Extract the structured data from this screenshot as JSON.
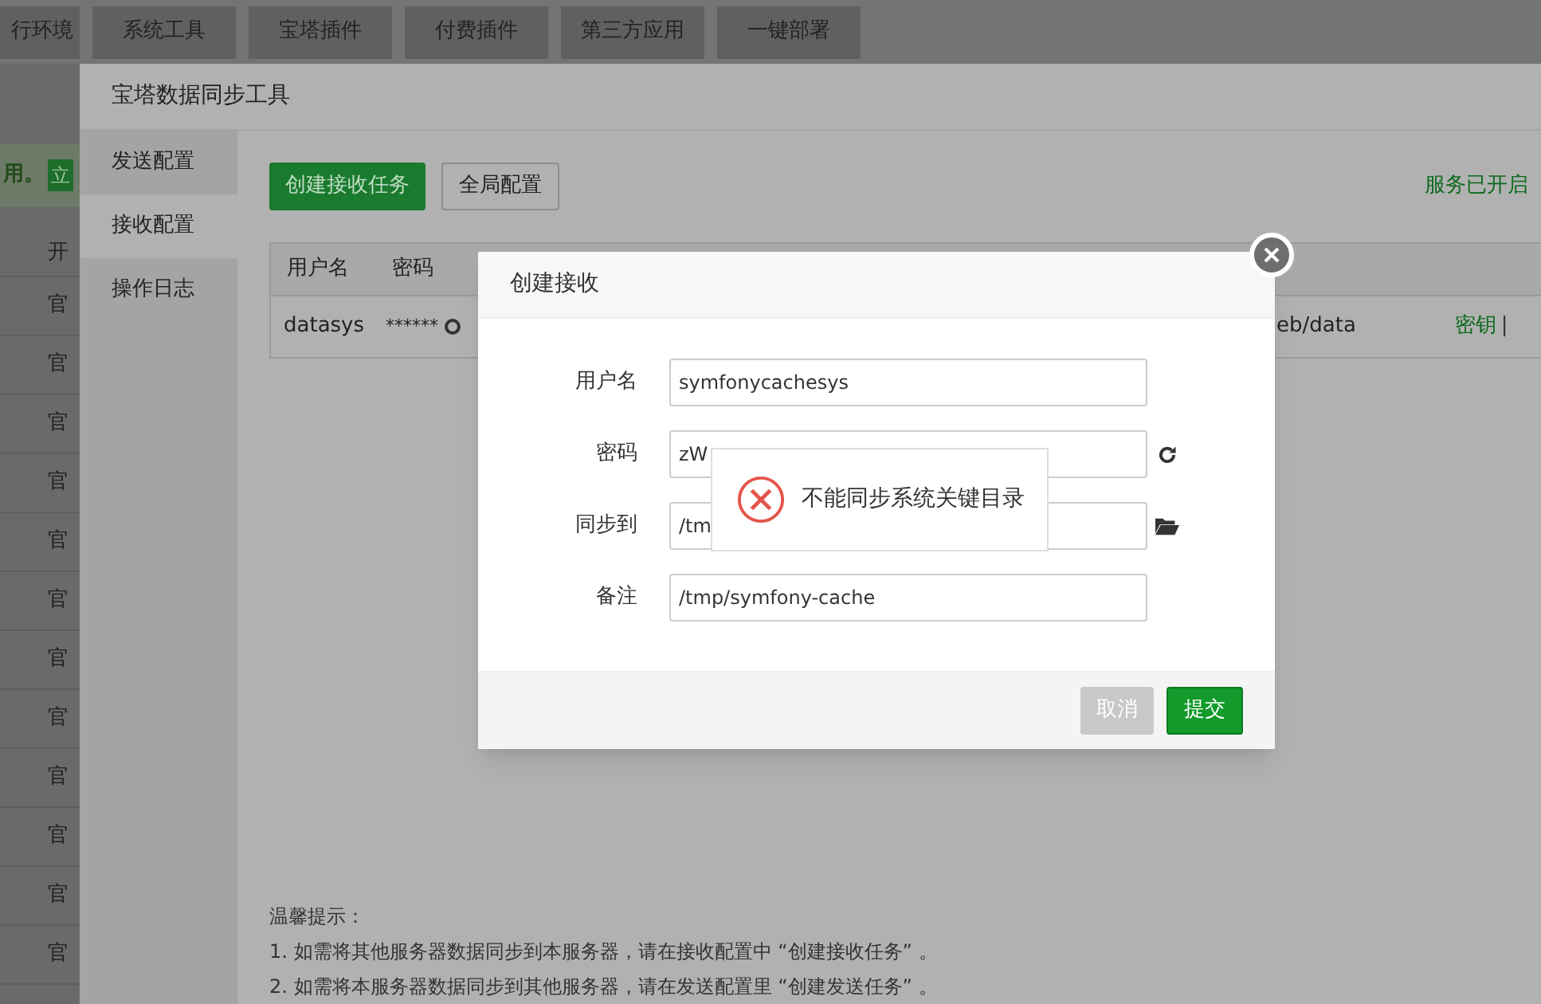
{
  "top_nav": [
    {
      "label": "行环境"
    },
    {
      "label": "系统工具"
    },
    {
      "label": "宝塔插件"
    },
    {
      "label": "付费插件"
    },
    {
      "label": "第三方应用"
    },
    {
      "label": "一键部署"
    }
  ],
  "background_page": {
    "notice_text": "用。",
    "notice_button": "立",
    "header_cell": "开",
    "rows": [
      "官",
      "官",
      "官",
      "官",
      "官",
      "官",
      "官",
      "官",
      "官",
      "官",
      "官",
      "官"
    ]
  },
  "panel": {
    "title": "宝塔数据同步工具",
    "sidebar": [
      {
        "label": "发送配置",
        "selected": false
      },
      {
        "label": "接收配置",
        "selected": true
      },
      {
        "label": "操作日志",
        "selected": false
      }
    ],
    "toolbar": {
      "create_button": "创建接收任务",
      "global_button": "全局配置",
      "status": "服务已开启"
    },
    "table": {
      "columns": [
        "用户名",
        "密码"
      ],
      "rows": [
        {
          "username": "datasys",
          "password": "******",
          "path": "eb/data",
          "actions": [
            "密钥",
            "|"
          ]
        }
      ]
    },
    "tips": {
      "title": "温馨提示：",
      "lines": [
        "1. 如需将其他服务器数据同步到本服务器，请在接收配置中 “创建接收任务” 。",
        "2. 如需将本服务器数据同步到其他服务器，请在发送配置里 “创建发送任务” 。"
      ]
    }
  },
  "dialog": {
    "title": "创建接收",
    "fields": [
      {
        "label": "用户名",
        "value": "symfonycachesys",
        "kind": "text"
      },
      {
        "label": "密码",
        "value": "zW",
        "kind": "refresh"
      },
      {
        "label": "同步到",
        "value": "/tm",
        "kind": "folder"
      },
      {
        "label": "备注",
        "value": "/tmp/symfony-cache",
        "kind": "text"
      }
    ],
    "buttons": [
      {
        "label": "取消",
        "disabled": true
      },
      {
        "label": "提交",
        "disabled": false
      }
    ]
  },
  "error_toast": {
    "message": "不能同步系统关键目录"
  }
}
